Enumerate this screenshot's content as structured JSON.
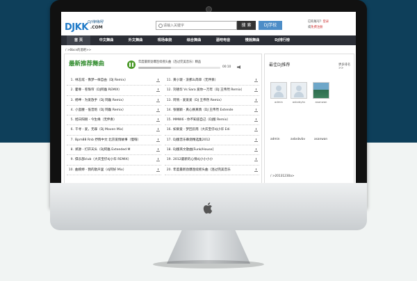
{
  "site": {
    "logo_tag": "DJ嗨嗨网",
    "logo_main": "DJKK",
    "logo_com": ".COM"
  },
  "search": {
    "placeholder": "请输入关键字",
    "button": "搜 索",
    "school": "DJ学校"
  },
  "header_right": {
    "line1_prefix": "已有账号？",
    "line1_link": "登录",
    "line2_prefix": "或",
    "line2_link": "免费注册"
  },
  "nav": [
    "首 页",
    "中文舞曲",
    "外文舞曲",
    "现场串烧",
    "综合舞曲",
    "酒吧电音",
    "慢摇舞曲",
    "DJ排行榜"
  ],
  "breadcrumb": "/ >Bbcn的酒吧>>",
  "section_title": "最新推荐舞曲",
  "player": {
    "title": "年度最新劲爆连续摇头曲（连过完美音乐）精品",
    "time": "00:10",
    "progress": 0.4
  },
  "songs_left": [
    {
      "num": "1.",
      "name": "林志炫 - 像梦一样自由（DJ Remix）"
    },
    {
      "num": "2.",
      "name": "霍尊 - 卷珠帘（DJ阿磊 REMIX）"
    },
    {
      "num": "3.",
      "name": "杨坤 - 为爱放手（DJ 阿磊 Remix）"
    },
    {
      "num": "4.",
      "name": "小蛮腰 - 低音炮（DJ 阿磊 Remix）"
    },
    {
      "num": "5.",
      "name": "旭日阳刚 - 今生缘（无伴奏）"
    },
    {
      "num": "6.",
      "name": "千寻 - 爱，无罪（Dj Moven Mix）"
    },
    {
      "num": "7.",
      "name": "Bpm88 Rnb 抒情中文 北京爱情故事（慢嗨）"
    },
    {
      "num": "8.",
      "name": "郑源 - 打开天头（DJ阿磊 Extended M"
    },
    {
      "num": "9.",
      "name": "俱乐部club（大庆宝仔dj小华 REMIX）"
    },
    {
      "num": "10.",
      "name": "曲婉婷 - 我的歌声里（dj阿好 Mix）"
    }
  ],
  "songs_right": [
    {
      "num": "11.",
      "name": "黄小琥 - 没那么简单（无伴奏）"
    },
    {
      "num": "12.",
      "name": "刘德华 Vs Sara 爱你一万年（DJ 王伟然 Remix）"
    },
    {
      "num": "13.",
      "name": "阿悄 - 爱爱爱（DJ 王伟然 Remix）"
    },
    {
      "num": "14.",
      "name": "张靓颖 - 真心换真情（DJ 王伟然 Extende"
    },
    {
      "num": "15.",
      "name": "MMW6 - 你不知道自己（DJ版 Remix）"
    },
    {
      "num": "16.",
      "name": "如果爱 - 梦回云南（大庆宝仔dj小华 Edi"
    },
    {
      "num": "17.",
      "name": "DJ版音乐串烧精选集2012"
    },
    {
      "num": "18.",
      "name": "DJ版英文歌曲[Funk/House]"
    },
    {
      "num": "19.",
      "name": "2012最新的心情dj小小小小"
    },
    {
      "num": "20.",
      "name": "年度最新劲爆连续摇头曲（连过完美音乐"
    }
  ],
  "sidebar": {
    "title": "最佳DJ推荐",
    "more": "更多排名>>",
    "djs": [
      {
        "name": "admin",
        "avatar": "person"
      },
      {
        "name": "avbvbyhv",
        "avatar": "person"
      },
      {
        "name": "asanwan",
        "avatar": "photo"
      }
    ],
    "dj_names_row": [
      "admin",
      "avbvbvbv",
      "asanwan"
    ],
    "bottom_link": "/ >20131230a>"
  },
  "colors": {
    "nav_bg": "#2b2e36",
    "section_title": "#2f8b2b",
    "play_button": "#4c9a2a",
    "school_button": "#4d8dc7",
    "logo_blue": "#1f7ac8"
  },
  "icons": [
    "search-icon",
    "play-pause-icon",
    "volume-icon",
    "download-icon",
    "apple-logo-icon",
    "camera-icon"
  ]
}
